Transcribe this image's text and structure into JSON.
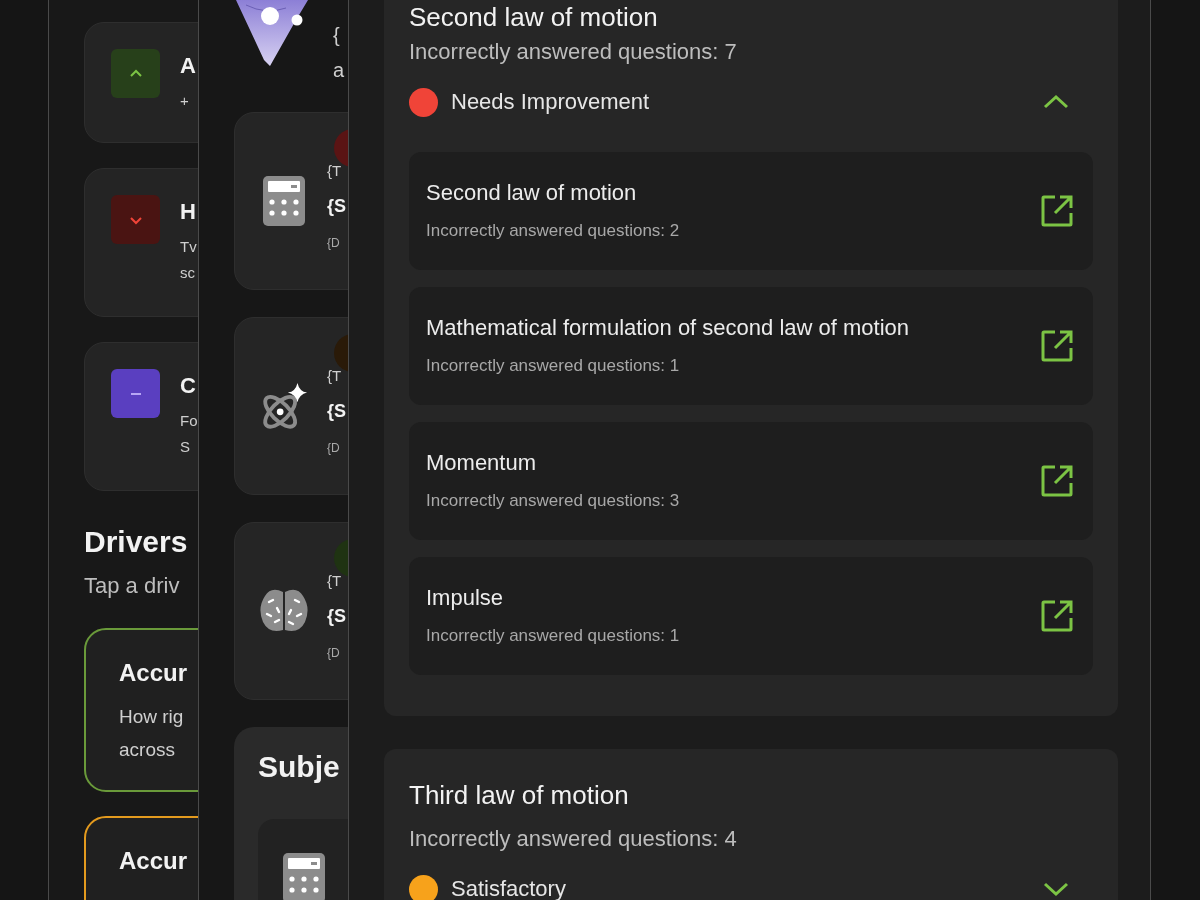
{
  "left_screen": {
    "cards": [
      {
        "kind": "up",
        "title": "A",
        "lines": [
          "+"
        ]
      },
      {
        "kind": "down",
        "title": "H",
        "lines": [
          "Tv",
          "sc"
        ]
      },
      {
        "kind": "neutral",
        "title": "C",
        "lines": [
          "Fo",
          "S"
        ]
      }
    ],
    "section_title": "Drivers",
    "section_subtitle": "Tap a driv",
    "drivers": [
      {
        "title": "Accur",
        "lines": [
          "How rig",
          "across"
        ],
        "color": "#6a9a3a"
      },
      {
        "title": "Accur",
        "color": "#e39a1e"
      }
    ]
  },
  "middle_screen": {
    "header_lines": [
      "{",
      "a"
    ],
    "subjects": [
      {
        "kind": "calculator",
        "color": "#5a1414",
        "lines": [
          "{T",
          "{S",
          "{D"
        ]
      },
      {
        "kind": "atom",
        "color": "#2a1a08",
        "lines": [
          "{T",
          "{S",
          "{D"
        ]
      },
      {
        "kind": "brain",
        "color": "#1f3312",
        "lines": [
          "{T",
          "{S",
          "{D"
        ]
      }
    ],
    "panel_title": "Subje",
    "panel_items": [
      {
        "kind": "calculator"
      }
    ]
  },
  "right_screen": {
    "topics": [
      {
        "title": "Second law of motion",
        "subtitle": "Incorrectly answered questions: 7",
        "status": "Needs Improvement",
        "color": "#f04438",
        "expanded": true,
        "subtopics": [
          {
            "title": "Second law of motion",
            "subtitle": "Incorrectly answered questions: 2"
          },
          {
            "title": "Mathematical formulation of second law of motion",
            "subtitle": "Incorrectly answered questions: 1"
          },
          {
            "title": "Momentum",
            "subtitle": "Incorrectly answered questions: 3"
          },
          {
            "title": "Impulse",
            "subtitle": "Incorrectly answered questions: 1"
          }
        ]
      },
      {
        "title": "Third law of motion",
        "subtitle": "Incorrectly answered questions: 4",
        "status": "Satisfactory",
        "color": "#f7a21b",
        "expanded": false
      }
    ]
  }
}
